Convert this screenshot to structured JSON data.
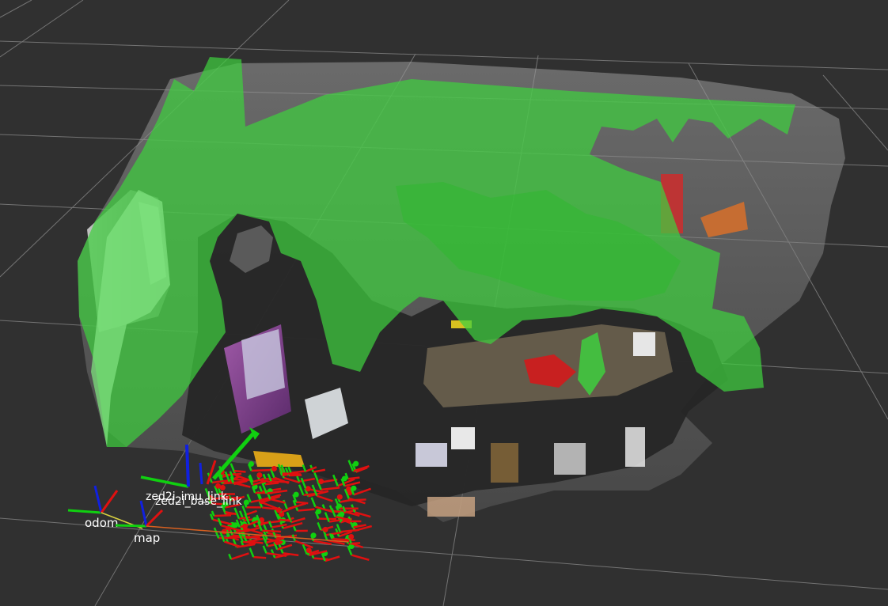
{
  "viewer": {
    "background_color": "#303030",
    "grid_color": "#a0a0a0"
  },
  "cloud": {
    "obstacle_color": "#3ecf3e",
    "floor_color": "#2b2b2b"
  },
  "frames": {
    "odom_label": "odom",
    "map_label": "map",
    "zed_labels": [
      "zed2i_imu_link",
      "zed2i_base_link"
    ],
    "axis_x_color": "#e01010",
    "axis_y_color": "#10d010",
    "axis_z_color": "#1020e0"
  }
}
